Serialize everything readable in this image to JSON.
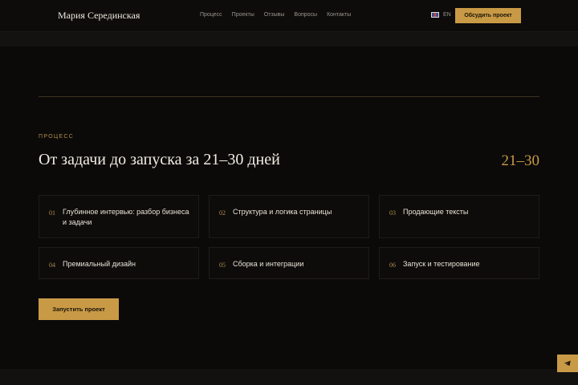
{
  "header": {
    "brand": "Мария Серединская",
    "nav": [
      "Процесс",
      "Проекты",
      "Отзывы",
      "Вопросы",
      "Контакты"
    ],
    "lang": "EN",
    "cta": "Обсудить проект"
  },
  "process": {
    "eyebrow": "ПРОЦЕСС",
    "title": "От задачи до запуска за 21–30 дней",
    "range": "21–30",
    "steps": [
      {
        "num": "01",
        "label": "Глубинное интервью: разбор бизнеса и задачи"
      },
      {
        "num": "02",
        "label": "Структура и логика страницы"
      },
      {
        "num": "03",
        "label": "Продающие тексты"
      },
      {
        "num": "04",
        "label": "Премиальный дизайн"
      },
      {
        "num": "05",
        "label": "Сборка и интеграции"
      },
      {
        "num": "06",
        "label": "Запуск и тестирование"
      }
    ],
    "button": "Запустить проект"
  },
  "colors": {
    "accent": "#c99a46",
    "background": "#0b0a09"
  },
  "icons": {
    "lang_flag": "uk-flag-icon",
    "float_button": "telegram-icon"
  }
}
